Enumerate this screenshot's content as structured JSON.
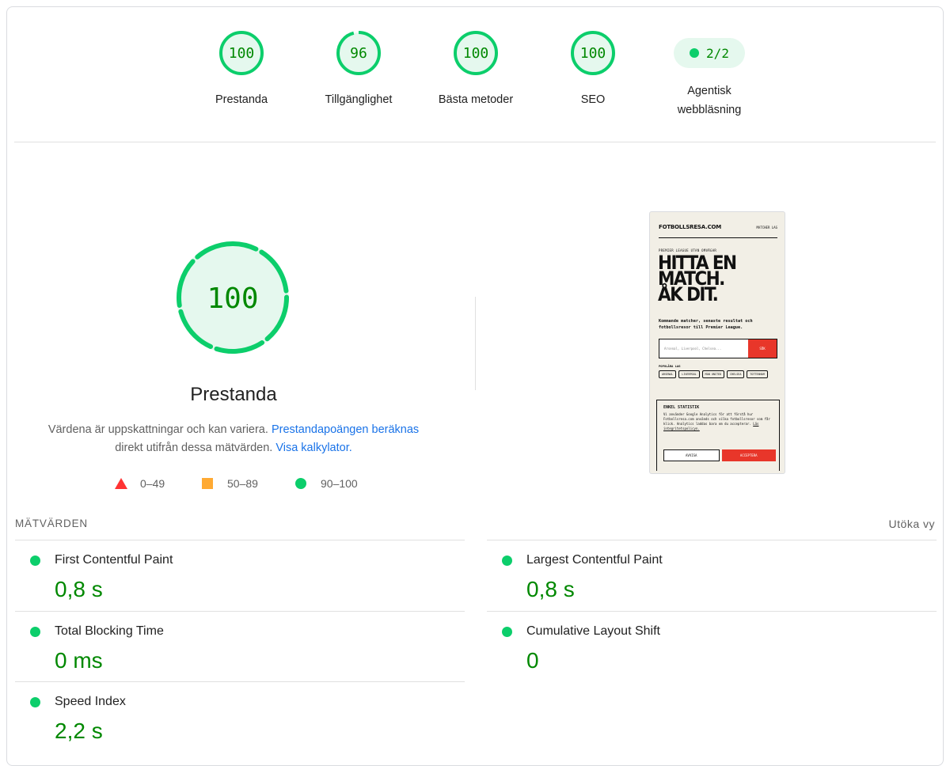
{
  "summary": {
    "gauges": [
      {
        "label": "Prestanda",
        "score": "100",
        "fraction": 1.0
      },
      {
        "label": "Tillgänglighet",
        "score": "96",
        "fraction": 0.96
      },
      {
        "label": "Bästa metoder",
        "score": "100",
        "fraction": 1.0
      },
      {
        "label": "SEO",
        "score": "100",
        "fraction": 1.0
      }
    ],
    "agentic": {
      "value": "2/2",
      "label_line1": "Agentisk",
      "label_line2": "webbläsning"
    }
  },
  "performance": {
    "score": "100",
    "title": "Prestanda",
    "desc_part1": "Värdena är uppskattningar och kan variera.",
    "desc_link1": "Prestandapoängen beräknas",
    "desc_part2": "direkt utifrån dessa mätvärden.",
    "desc_link2": "Visa kalkylator.",
    "legend": {
      "fail": "0–49",
      "average": "50–89",
      "pass": "90–100"
    }
  },
  "thumbnail": {
    "logo": "FOTBOLLSRESA.COM",
    "nav": "MATCHER   LAG",
    "kicker": "PREMIER LEAGUE UTAN OMVÄGAR",
    "hero_line1": "HITTA EN",
    "hero_line2": "MATCH.",
    "hero_line3": "ÅK DIT.",
    "subtitle": "Kommande matcher, senaste resultat och fotbollsresor till Premier League.",
    "search_placeholder": "Arsenal, Liverpool, Chelsea...",
    "search_button": "SÖK",
    "popular_label": "POPULÄRA LAG",
    "chips": [
      "ARSENAL",
      "LIVERPOOL",
      "MAN UNITED",
      "CHELSEA",
      "TOTTENHAM"
    ],
    "cookie_title": "ENKEL STATISTIK",
    "cookie_text": "Vi använder Google Analytics för att förstå hur Fotbollsresa.com används och vilka fotbollsresor som får klick. Analytics laddas bara om du accepterar.",
    "cookie_link": "Läs integritetspolicyn.",
    "decline": "AVVISA",
    "accept": "ACCEPTERA"
  },
  "metrics": {
    "title": "MÄTVÄRDEN",
    "expand": "Utöka vy",
    "items": [
      {
        "label": "First Contentful Paint",
        "value": "0,8 s"
      },
      {
        "label": "Largest Contentful Paint",
        "value": "0,8 s"
      },
      {
        "label": "Total Blocking Time",
        "value": "0 ms"
      },
      {
        "label": "Cumulative Layout Shift",
        "value": "0"
      },
      {
        "label": "Speed Index",
        "value": "2,2 s"
      }
    ]
  },
  "colors": {
    "pass": "#0cce6b",
    "pass_text": "#008800",
    "average": "#ffaa33",
    "fail": "#ff3333",
    "link": "#1a73e8"
  }
}
